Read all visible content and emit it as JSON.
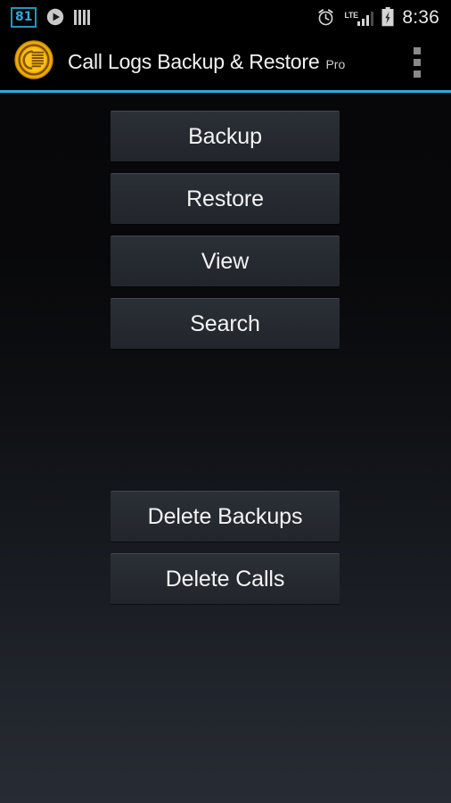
{
  "status_bar": {
    "left_icons": [
      {
        "name": "notification-count-badge",
        "label": "81"
      },
      {
        "name": "play-icon",
        "label": ""
      },
      {
        "name": "equalizer-bars-icon",
        "label": ""
      }
    ],
    "notification_count": "81",
    "right_icons": [
      {
        "name": "alarm-clock-icon",
        "label": ""
      },
      {
        "name": "lte-signal-icon",
        "label": "LTE"
      },
      {
        "name": "battery-charging-icon",
        "label": ""
      }
    ],
    "network_label": "LTE",
    "time": "8:36"
  },
  "app_bar": {
    "icon_name": "call-logs-app-icon",
    "title": "Call Logs Backup & Restore",
    "title_suffix": "Pro",
    "overflow_menu_name": "overflow-menu-icon"
  },
  "theme": {
    "accent": "#2cabe3",
    "app_icon_gold": "#f5b400",
    "button_face": "#262a31",
    "button_top_edge": "#414751",
    "text_primary": "#f4f4f4",
    "status_bar_bg": "#000000"
  },
  "main": {
    "primary_actions": [
      {
        "id": "backup",
        "label": "Backup"
      },
      {
        "id": "restore",
        "label": "Restore"
      },
      {
        "id": "view",
        "label": "View"
      },
      {
        "id": "search",
        "label": "Search"
      }
    ],
    "danger_actions": [
      {
        "id": "delete-backups",
        "label": "Delete Backups"
      },
      {
        "id": "delete-calls",
        "label": "Delete Calls"
      }
    ]
  }
}
